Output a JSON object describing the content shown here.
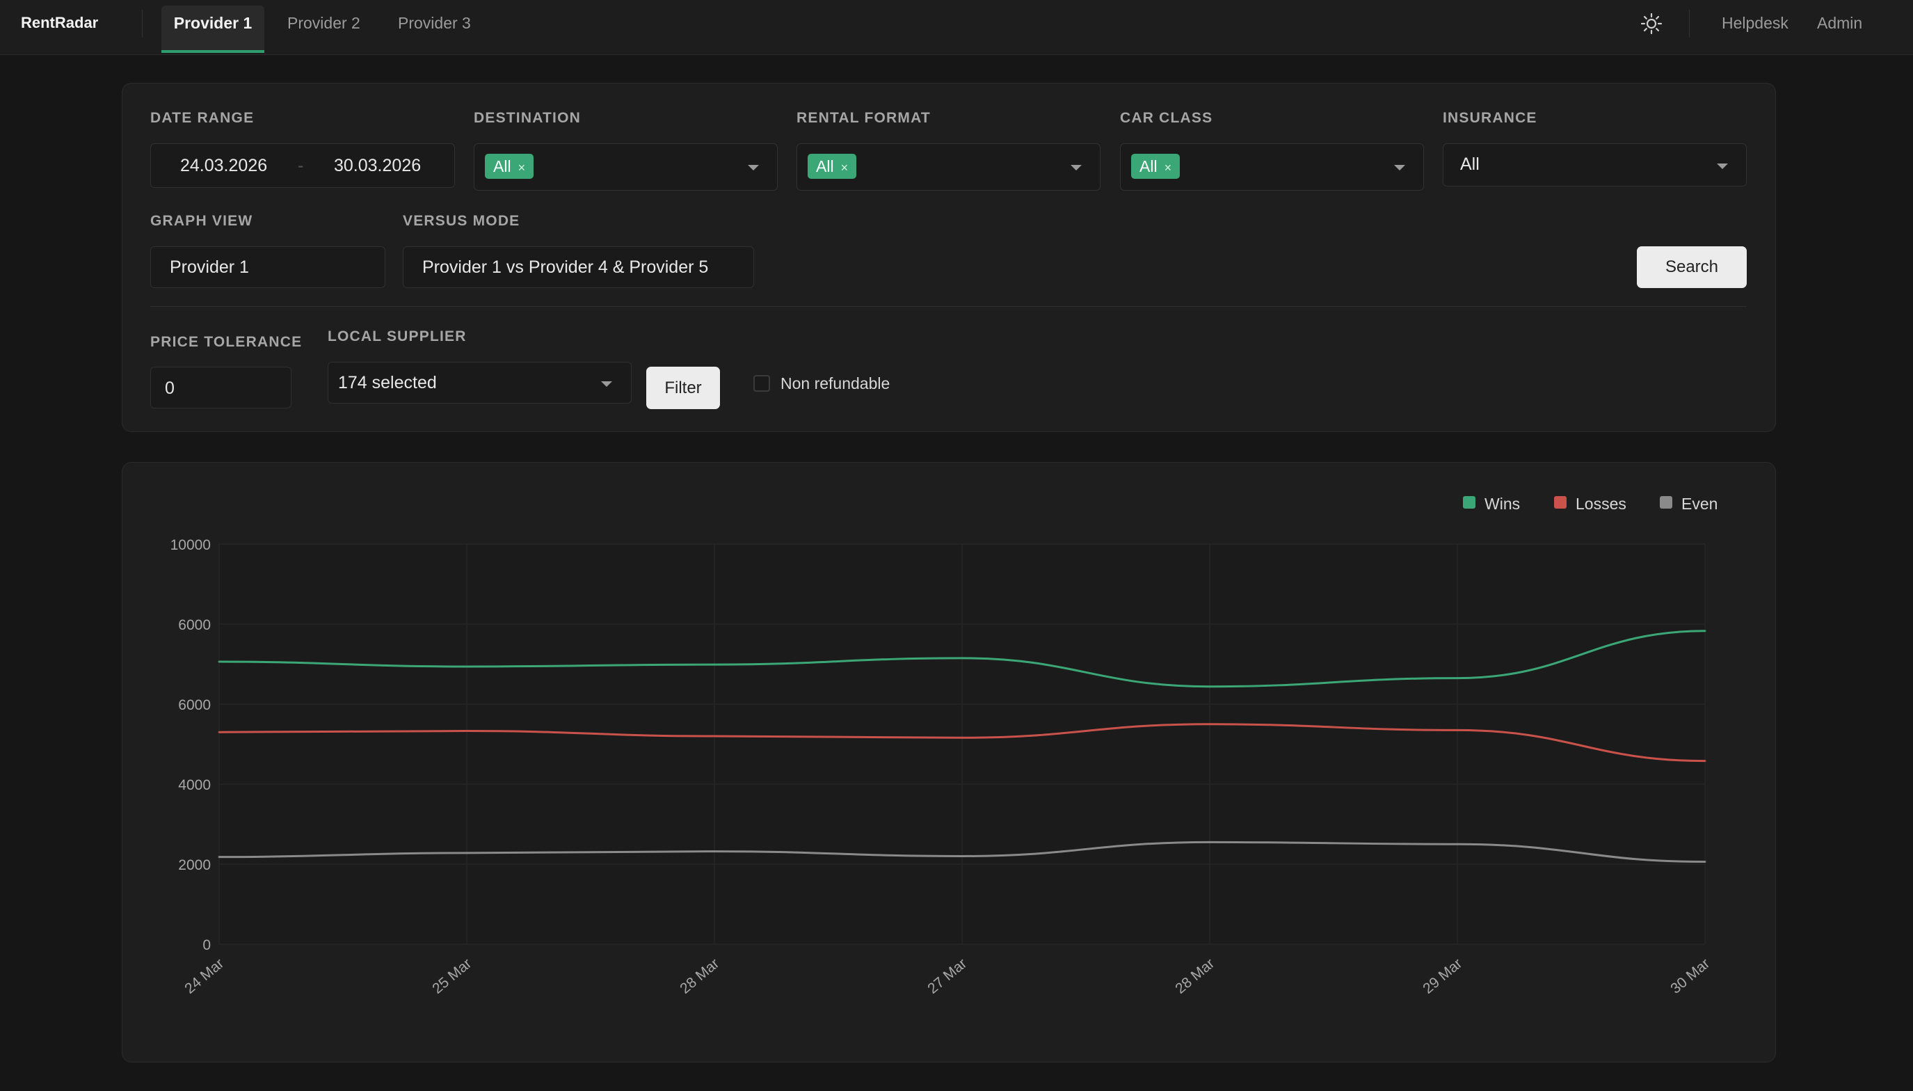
{
  "app": {
    "brand": "RentRadar"
  },
  "nav": {
    "tabs": [
      {
        "label": "Provider 1",
        "active": true
      },
      {
        "label": "Provider 2",
        "active": false
      },
      {
        "label": "Provider 3",
        "active": false
      }
    ],
    "theme_icon": "sun-icon",
    "links": [
      "Helpdesk",
      "Admin"
    ]
  },
  "filters": {
    "date_range": {
      "label": "DATE RANGE",
      "from": "24.03.2026",
      "sep": "-",
      "to": "30.03.2026"
    },
    "destination": {
      "label": "DESTINATION",
      "chip": "All",
      "chip_close": "×"
    },
    "rental_format": {
      "label": "RENTAL FORMAT",
      "chip": "All",
      "chip_close": "×"
    },
    "car_class": {
      "label": "CAR CLASS",
      "chip": "All",
      "chip_close": "×"
    },
    "insurance": {
      "label": "INSURANCE",
      "value": "All"
    },
    "graph_view": {
      "label": "GRAPH VIEW",
      "value": "Provider 1"
    },
    "versus_mode": {
      "label": "VERSUS MODE",
      "value": "Provider 1 vs Provider 4 & Provider 5"
    },
    "search_button": "Search",
    "price_tolerance": {
      "label": "PRICE TOLERANCE",
      "value": "0"
    },
    "local_supplier": {
      "label": "LOCAL SUPPLIER",
      "value": "174 selected"
    },
    "filter_button": "Filter",
    "non_refundable": {
      "label": "Non refundable",
      "checked": false
    },
    "chip_color": "#3ba776"
  },
  "chart_data": {
    "type": "line",
    "x": [
      "24 Mar",
      "25 Mar",
      "28 Mar",
      "27 Mar",
      "28 Mar",
      "29 Mar",
      "30 Mar"
    ],
    "y_ticks": [
      "0",
      "2000",
      "4000",
      "6000",
      "6000",
      "10000"
    ],
    "ylim": [
      0,
      10000
    ],
    "grid": true,
    "legend_position": "top-right",
    "series": [
      {
        "name": "Wins",
        "color": "#3ba776",
        "values": [
          7060,
          6940,
          6990,
          7150,
          6440,
          6650,
          7830
        ]
      },
      {
        "name": "Losses",
        "color": "#c9524a",
        "values": [
          5300,
          5330,
          5200,
          5160,
          5500,
          5350,
          4580
        ]
      },
      {
        "name": "Even",
        "color": "#8a8a8a",
        "values": [
          2180,
          2280,
          2320,
          2200,
          2550,
          2500,
          2060
        ]
      }
    ]
  }
}
